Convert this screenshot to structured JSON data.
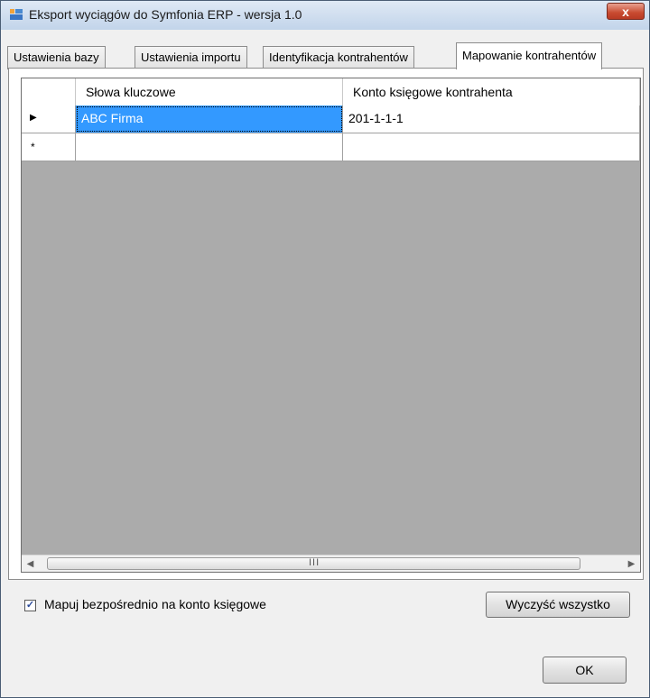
{
  "window": {
    "title": "Eksport wyciągów do Symfonia ERP - wersja 1.0",
    "close_glyph": "x",
    "icon": "app-window-icon"
  },
  "tabs": [
    {
      "label": "Ustawienia bazy",
      "active": false
    },
    {
      "label": "Ustawienia importu",
      "active": false
    },
    {
      "label": "Identyfikacja kontrahentów",
      "active": false
    },
    {
      "label": "Mapowanie kontrahentów",
      "active": true
    }
  ],
  "grid": {
    "columns": [
      "Słowa kluczowe",
      "Konto księgowe kontrahenta"
    ],
    "rows": [
      {
        "indicator": "▶",
        "keywords": "ABC Firma",
        "account": "201-1-1-1"
      },
      {
        "indicator": "*",
        "keywords": "",
        "account": ""
      }
    ],
    "scroll_grip": "III"
  },
  "options": {
    "map_direct_label": "Mapuj bezpośrednio na konto księgowe",
    "map_direct_checked": true
  },
  "buttons": {
    "clear_all": "Wyczyść wszystko",
    "ok": "OK"
  }
}
